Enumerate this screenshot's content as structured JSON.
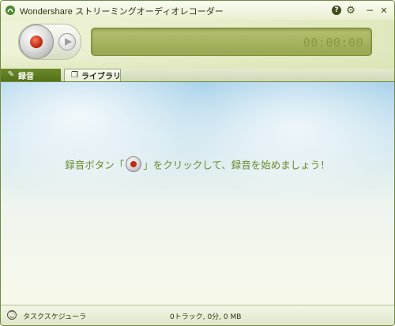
{
  "window": {
    "title": "Wondershare ストリーミングオーディオレコーダー",
    "controls": {
      "help_icon": "?",
      "settings_icon": "⚙",
      "minimize_icon": "−",
      "close_icon": "✕"
    }
  },
  "recorder": {
    "time_display": "00:00:00"
  },
  "tabs": [
    {
      "label": "録音",
      "icon": "pen-icon",
      "active": true
    },
    {
      "label": "ライブラリ",
      "icon": "library-icon",
      "active": false
    }
  ],
  "main": {
    "hint_before": "録音ボタン「",
    "hint_after": "」をクリックして、録音を始めましょう！"
  },
  "status": {
    "scheduler_label": "タスクスケジューラ",
    "summary": "0トラック, 0分, 0 MB"
  },
  "colors": {
    "accent_green": "#6b8a2a",
    "hint_text": "#6a8a2a",
    "record_red": "#c22a10"
  }
}
